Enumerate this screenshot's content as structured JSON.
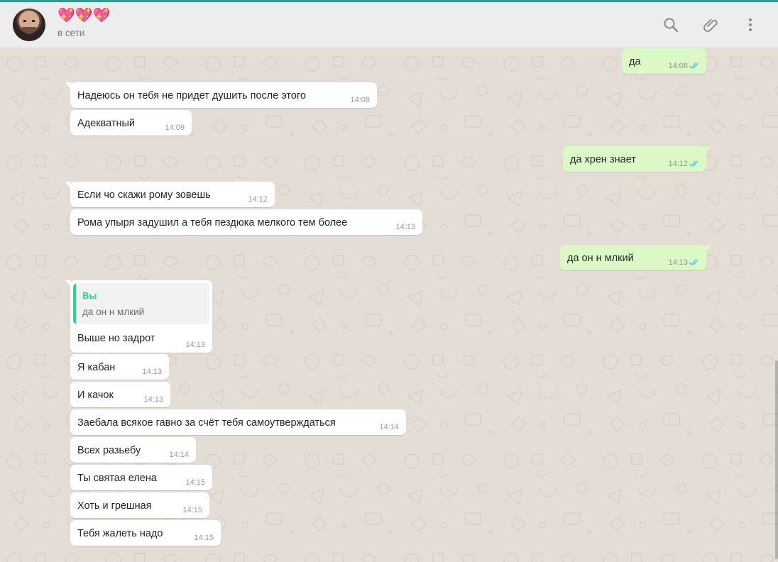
{
  "header": {
    "contact_name": "💖💖💖",
    "status": "в сети",
    "icons": [
      "search-icon",
      "attach-icon",
      "menu-icon"
    ]
  },
  "colors": {
    "incoming": "#ffffff",
    "outgoing": "#dcf8c6",
    "read_ticks": "#4fc3f7",
    "quote_accent": "#35cd96"
  },
  "messages": [
    {
      "dir": "out",
      "text": "да",
      "time": "14:08",
      "read": true
    },
    {
      "dir": "in",
      "text": "Надеюсь он тебя не придет душить после этого",
      "time": "14:08"
    },
    {
      "dir": "in",
      "text": "Адекватный",
      "time": "14:09"
    },
    {
      "dir": "out",
      "text": "да хрен знает",
      "time": "14:12",
      "read": true
    },
    {
      "dir": "in",
      "text": "Если чо скажи рому зовешь",
      "time": "14:12"
    },
    {
      "dir": "in",
      "text": "Рома упыря задушил а тебя пездюка мелкого тем более",
      "time": "14:13"
    },
    {
      "dir": "out",
      "text": "да он н млкий",
      "time": "14:13",
      "read": true
    },
    {
      "dir": "in",
      "text": "Выше но задрот",
      "time": "14:13",
      "quote": {
        "author": "Вы",
        "text": "да он н млкий"
      }
    },
    {
      "dir": "in",
      "text": "Я кабан",
      "time": "14:13"
    },
    {
      "dir": "in",
      "text": "И качок",
      "time": "14:13"
    },
    {
      "dir": "in",
      "text": "Заебала всякое гавно за счёт тебя самоутверждаться",
      "time": "14:14"
    },
    {
      "dir": "in",
      "text": "Всех разьебу",
      "time": "14:14"
    },
    {
      "dir": "in",
      "text": "Ты святая елена",
      "time": "14:15"
    },
    {
      "dir": "in",
      "text": "Хоть и грешная",
      "time": "14:15"
    },
    {
      "dir": "in",
      "text": "Тебя жалеть надо",
      "time": "14:15"
    }
  ]
}
